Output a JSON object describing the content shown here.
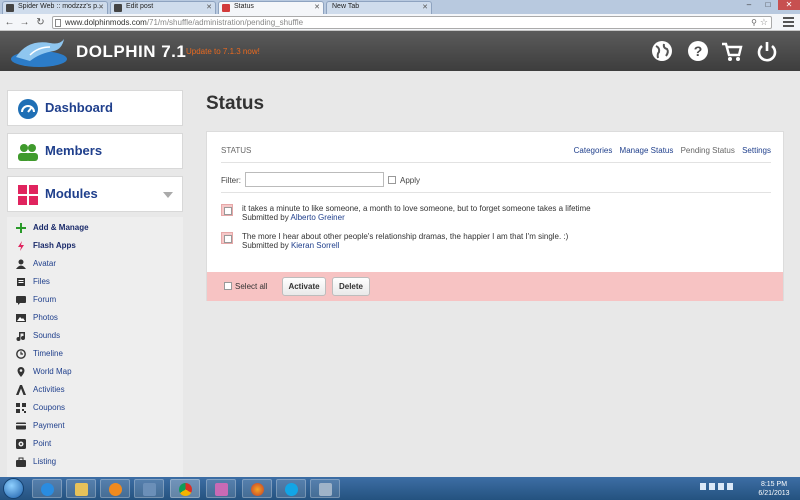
{
  "browser": {
    "tabs": [
      {
        "label": "Spider Web :: modzzz's p..."
      },
      {
        "label": "Edit post"
      },
      {
        "label": "Status"
      },
      {
        "label": "New Tab"
      }
    ],
    "url_host": "www.dolphinmods.com",
    "url_path": "/71/m/shuffle/administration/pending_shuffle"
  },
  "header": {
    "brand": "DOLPHIN 7.1",
    "update_link": "Update to 7.1.3 now!",
    "icons": [
      "globe-icon",
      "help-icon",
      "cart-icon",
      "power-icon"
    ]
  },
  "sidebar": {
    "sections": [
      {
        "label": "Dashboard",
        "icon": "dashboard-icon"
      },
      {
        "label": "Members",
        "icon": "members-icon"
      },
      {
        "label": "Modules",
        "icon": "modules-icon"
      }
    ],
    "modules": [
      {
        "label": "Add & Manage",
        "icon": "plus-icon",
        "color": "#2a9a2a"
      },
      {
        "label": "Flash Apps",
        "icon": "lightning-icon",
        "color": "#e0245e"
      },
      {
        "label": "Avatar",
        "icon": "person-icon"
      },
      {
        "label": "Files",
        "icon": "files-icon"
      },
      {
        "label": "Forum",
        "icon": "forum-icon"
      },
      {
        "label": "Photos",
        "icon": "photos-icon"
      },
      {
        "label": "Sounds",
        "icon": "music-icon"
      },
      {
        "label": "Timeline",
        "icon": "clock-icon"
      },
      {
        "label": "World Map",
        "icon": "pin-icon"
      },
      {
        "label": "Activities",
        "icon": "activities-icon"
      },
      {
        "label": "Coupons",
        "icon": "qr-icon"
      },
      {
        "label": "Payment",
        "icon": "card-icon"
      },
      {
        "label": "Point",
        "icon": "point-icon"
      },
      {
        "label": "Listing",
        "icon": "briefcase-icon"
      }
    ]
  },
  "main": {
    "title": "Status",
    "panel_title": "STATUS",
    "menu": [
      {
        "label": "Categories"
      },
      {
        "label": "Manage Status"
      },
      {
        "label": "Pending Status"
      },
      {
        "label": "Settings"
      }
    ],
    "filter_label": "Filter:",
    "filter_value": "",
    "apply_label": "Apply",
    "submitted_prefix": "Submitted by",
    "items": [
      {
        "text": "it takes a minute to like someone, a month to love someone, but to forget someone takes a lifetime",
        "user": "Alberto Greiner"
      },
      {
        "text": "The more I hear about other people's relationship dramas, the happier I am that I'm single. :)",
        "user": "Kieran Sorrell"
      }
    ],
    "select_all": "Select all",
    "activate": "Activate",
    "delete": "Delete"
  },
  "taskbar": {
    "time": "8:15 PM",
    "date": "6/21/2013"
  },
  "colors": {
    "accent": "#1f3f8c",
    "update": "#e8691f",
    "action_bar": "#f7c3c3"
  }
}
